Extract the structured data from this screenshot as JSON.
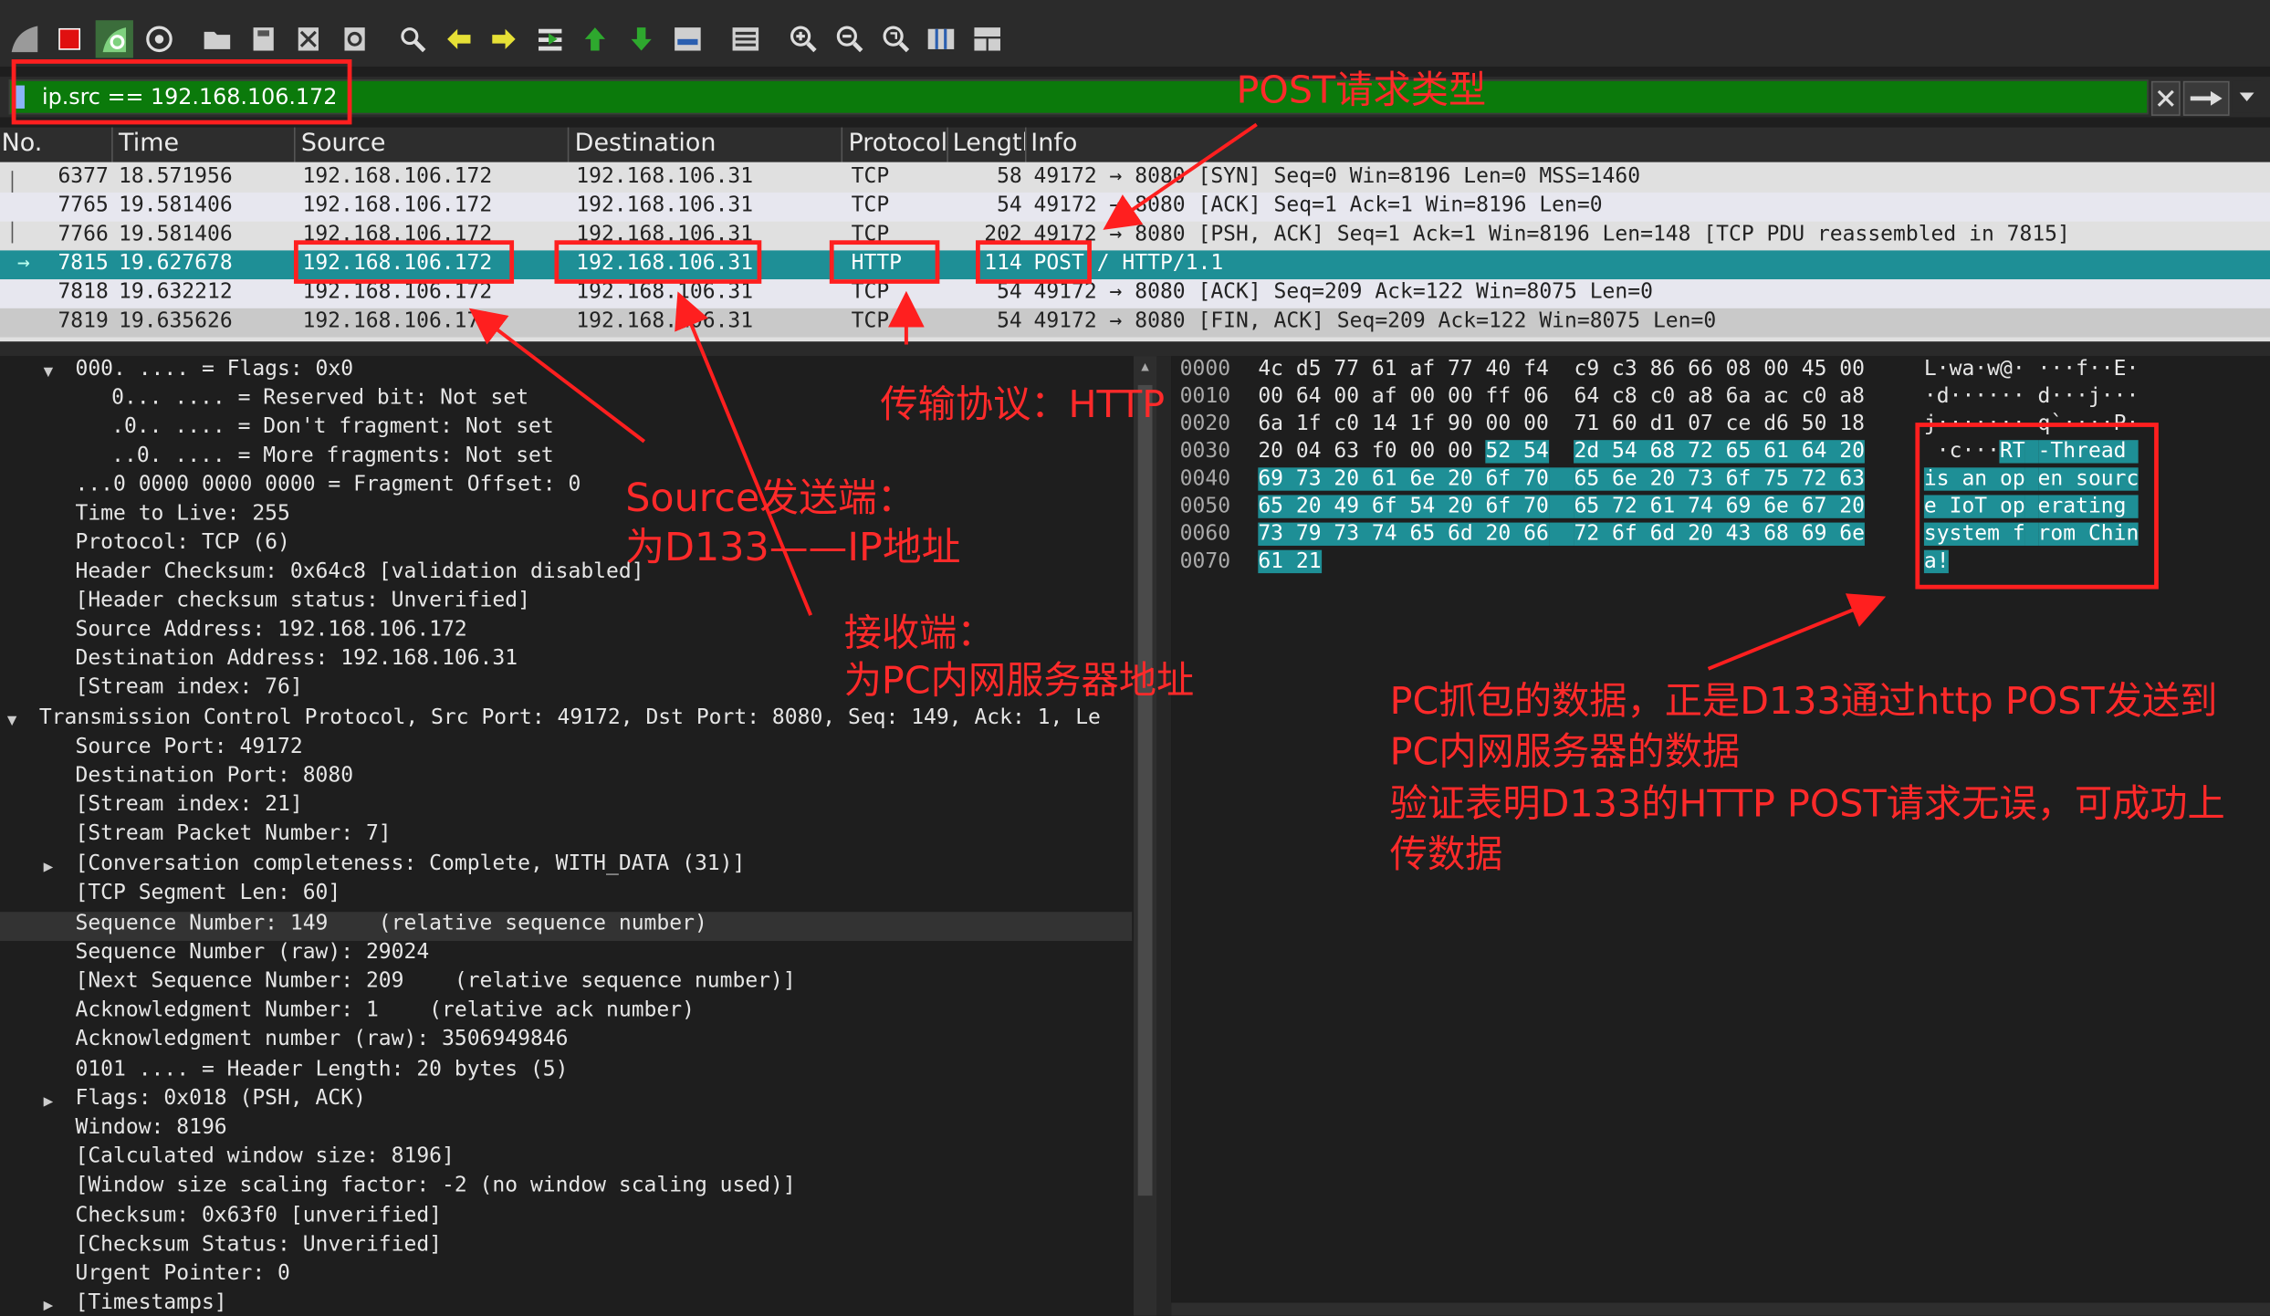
{
  "filter": {
    "value": "ip.src == 192.168.106.172"
  },
  "columns": [
    "No.",
    "Time",
    "Source",
    "Destination",
    "Protocol",
    "Length",
    "Info"
  ],
  "packets": [
    {
      "no": "6377",
      "time": "18.571956",
      "src": "192.168.106.172",
      "dst": "192.168.106.31",
      "proto": "TCP",
      "len": "58",
      "info": "49172 → 8080 [SYN] Seq=0 Win=8196 Len=0 MSS=1460"
    },
    {
      "no": "7765",
      "time": "19.581406",
      "src": "192.168.106.172",
      "dst": "192.168.106.31",
      "proto": "TCP",
      "len": "54",
      "info": "49172 → 8080 [ACK] Seq=1 Ack=1 Win=8196 Len=0"
    },
    {
      "no": "7766",
      "time": "19.581406",
      "src": "192.168.106.172",
      "dst": "192.168.106.31",
      "proto": "TCP",
      "len": "202",
      "info": "49172 → 8080 [PSH, ACK] Seq=1 Ack=1 Win=8196 Len=148 [TCP PDU reassembled in 7815]"
    },
    {
      "no": "7815",
      "time": "19.627678",
      "src": "192.168.106.172",
      "dst": "192.168.106.31",
      "proto": "HTTP",
      "len": "114",
      "info": "POST / HTTP/1.1"
    },
    {
      "no": "7818",
      "time": "19.632212",
      "src": "192.168.106.172",
      "dst": "192.168.106.31",
      "proto": "TCP",
      "len": "54",
      "info": "49172 → 8080 [ACK] Seq=209 Ack=122 Win=8075 Len=0"
    },
    {
      "no": "7819",
      "time": "19.635626",
      "src": "192.168.106.172",
      "dst": "192.168.106.31",
      "proto": "TCP",
      "len": "54",
      "info": "49172 → 8080 [FIN, ACK] Seq=209 Ack=122 Win=8075 Len=0"
    }
  ],
  "details": [
    "000. .... = Flags: 0x0",
    "0... .... = Reserved bit: Not set",
    ".0.. .... = Don't fragment: Not set",
    "..0. .... = More fragments: Not set",
    "...0 0000 0000 0000 = Fragment Offset: 0",
    "Time to Live: 255",
    "Protocol: TCP (6)",
    "Header Checksum: 0x64c8 [validation disabled]",
    "[Header checksum status: Unverified]",
    "Source Address: 192.168.106.172",
    "Destination Address: 192.168.106.31",
    "[Stream index: 76]",
    "Transmission Control Protocol, Src Port: 49172, Dst Port: 8080, Seq: 149, Ack: 1, Le",
    "Source Port: 49172",
    "Destination Port: 8080",
    "[Stream index: 21]",
    "[Stream Packet Number: 7]",
    "[Conversation completeness: Complete, WITH_DATA (31)]",
    "[TCP Segment Len: 60]",
    "Sequence Number: 149    (relative sequence number)",
    "Sequence Number (raw): 29024",
    "[Next Sequence Number: 209    (relative sequence number)]",
    "Acknowledgment Number: 1    (relative ack number)",
    "Acknowledgment number (raw): 3506949846",
    "0101 .... = Header Length: 20 bytes (5)",
    "Flags: 0x018 (PSH, ACK)",
    "Window: 8196",
    "[Calculated window size: 8196]",
    "[Window size scaling factor: -2 (no window scaling used)]",
    "Checksum: 0x63f0 [unverified]",
    "[Checksum Status: Unverified]",
    "Urgent Pointer: 0",
    "[Timestamps]"
  ],
  "hex": [
    {
      "off": "0000",
      "b1": "4c d5 77 61 af 77 40 f4",
      "b2": "c9 c3 86 66 08 00 45 00",
      "a1": "L·wa·w@·",
      "a2": "···f··E·"
    },
    {
      "off": "0010",
      "b1": "00 64 00 af 00 00 ff 06",
      "b2": "64 c8 c0 a8 6a ac c0 a8",
      "a1": "·d······",
      "a2": "d···j···"
    },
    {
      "off": "0020",
      "b1": "6a 1f c0 14 1f 90 00 00",
      "b2": "71 60 d1 07 ce d6 50 18",
      "a1": "j·······",
      "a2": "q`····P·"
    },
    {
      "off": "0030",
      "b1": "20 04 63 f0 00 00",
      "b1s": "52 54",
      "b2": "2d 54 68 72 65 61 64 20",
      "a1": " ·c···",
      "a1s": "RT",
      "a2": "-Thread "
    },
    {
      "off": "0040",
      "b1s": "69 73 20 61 6e 20 6f 70",
      "b2": "65 6e 20 73 6f 75 72 63",
      "a1s": "is an op",
      "a2": "en sourc"
    },
    {
      "off": "0050",
      "b1s": "65 20 49 6f 54 20 6f 70",
      "b2": "65 72 61 74 69 6e 67 20",
      "a1s": "e IoT op",
      "a2": "erating "
    },
    {
      "off": "0060",
      "b1s": "73 79 73 74 65 6d 20 66",
      "b2": "72 6f 6d 20 43 68 69 6e",
      "a1s": "system f",
      "a2": "rom Chin"
    },
    {
      "off": "0070",
      "b1s": "61 21",
      "a1s": "a!"
    }
  ],
  "annotations": {
    "post_type": "POST请求类型",
    "protocol": "传输协议：HTTP",
    "source_1": "Source发送端：",
    "source_2": "为D133——IP地址",
    "receiver_1": "接收端：",
    "receiver_2": "为PC内网服务器地址",
    "verify_1": "PC抓包的数据，正是D133通过http POST发送到",
    "verify_2": "PC内网服务器的数据",
    "verify_3": "验证表明D133的HTTP POST请求无误，可成功上",
    "verify_4": "传数据"
  },
  "colors": {
    "filter_bg": "#0b7a0b",
    "selected_row": "#1e8f96",
    "annotation": "#ff2a2a"
  },
  "toolbar_icons": [
    "shark-fin-start-icon",
    "stop-icon",
    "restart-icon",
    "options-gear-icon",
    "open-folder-icon",
    "save-icon",
    "close-file-icon",
    "reload-icon",
    "find-icon",
    "back-icon",
    "forward-icon",
    "go-to-packet-icon",
    "first-packet-icon",
    "last-packet-icon",
    "autoscroll-icon",
    "colorize-icon",
    "zoom-in-icon",
    "zoom-out-icon",
    "zoom-reset-icon",
    "resize-columns-icon",
    "layout-icon"
  ]
}
